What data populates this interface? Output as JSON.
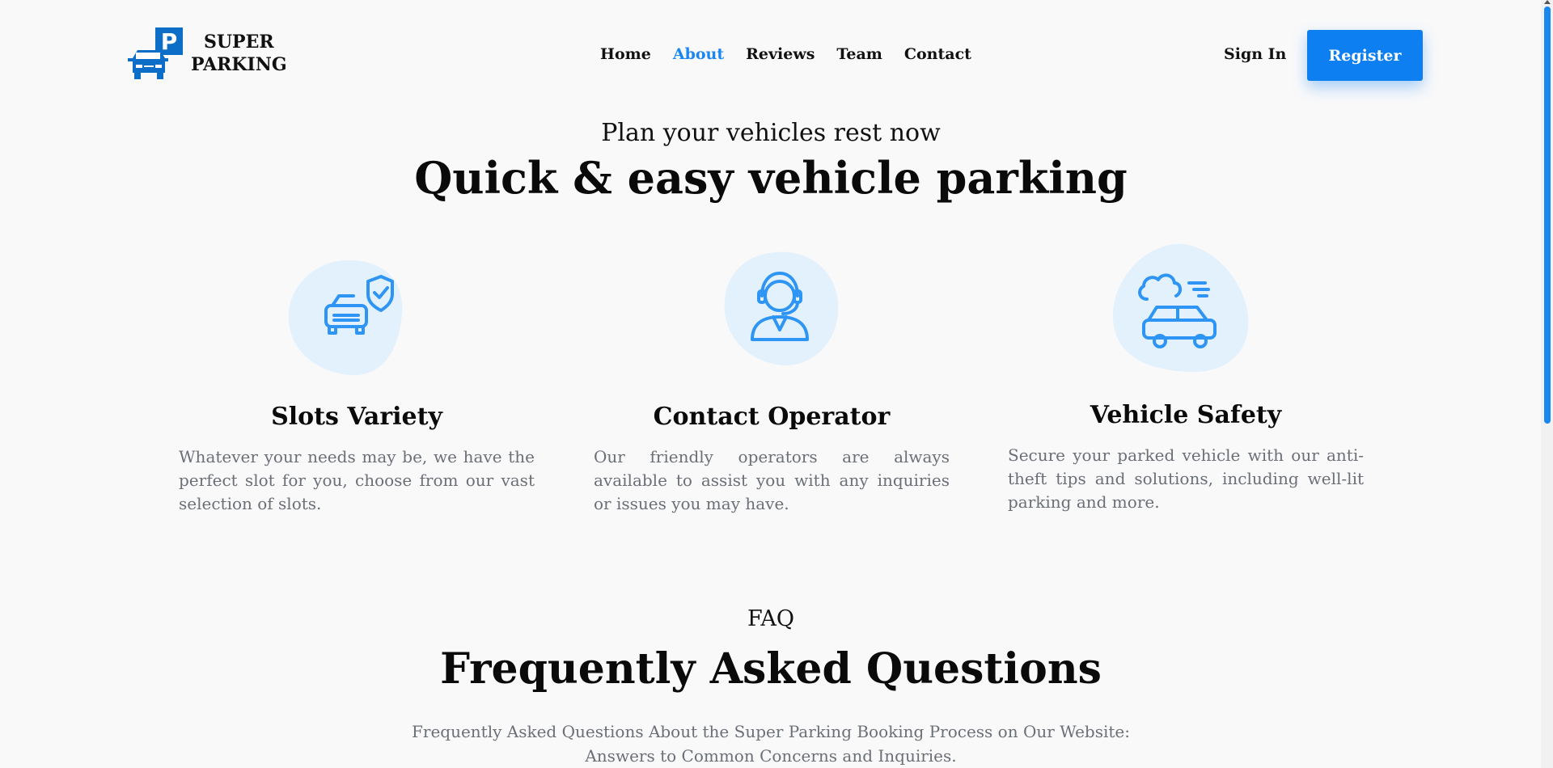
{
  "brand": {
    "line1": "SUPER",
    "line2": "PARKING",
    "logo_icon": "parking-car-icon",
    "logo_letter": "P"
  },
  "nav": {
    "items": [
      {
        "label": "Home",
        "active": false
      },
      {
        "label": "About",
        "active": true
      },
      {
        "label": "Reviews",
        "active": false
      },
      {
        "label": "Team",
        "active": false
      },
      {
        "label": "Contact",
        "active": false
      }
    ],
    "signin": "Sign In",
    "register": "Register"
  },
  "hero": {
    "subtitle": "Plan your vehicles rest now",
    "title": "Quick & easy vehicle parking"
  },
  "features": [
    {
      "icon": "car-shield-icon",
      "title": "Slots Variety",
      "text": "Whatever your needs may be, we have the perfect slot for you, choose from our vast selection of slots."
    },
    {
      "icon": "operator-headset-icon",
      "title": "Contact Operator",
      "text": "Our friendly operators are always available to assist you with any inquiries or issues you may have."
    },
    {
      "icon": "car-cloud-icon",
      "title": "Vehicle Safety",
      "text": "Secure your parked vehicle with our anti-theft tips and solutions, including well-lit parking and more."
    }
  ],
  "faq": {
    "label": "FAQ",
    "title": "Frequently Asked Questions",
    "description": "Frequently Asked Questions About the Super Parking Booking Process on Our Website: Answers to Common Concerns and Inquiries."
  },
  "colors": {
    "accent": "#0d7ff0",
    "active_nav": "#1a86f0",
    "logo_blue": "#0d6ec7",
    "icon_blue": "#2f95f5",
    "blob": "#e3f1fd"
  }
}
